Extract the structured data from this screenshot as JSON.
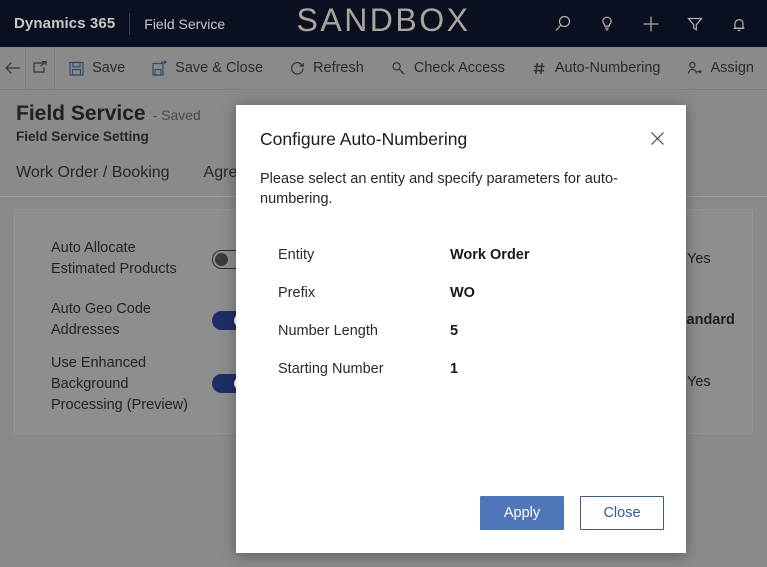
{
  "topbar": {
    "brand": "Dynamics 365",
    "app_name": "Field Service",
    "environment_label": "SANDBOX",
    "background_color": "#0b1021",
    "text_color": "#c9c7c4",
    "icons": [
      {
        "name": "search-icon",
        "label": "Search"
      },
      {
        "name": "lightbulb-icon",
        "label": "Assistant"
      },
      {
        "name": "plus-icon",
        "label": "Quick Create"
      },
      {
        "name": "filter-icon",
        "label": "Filter"
      },
      {
        "name": "bell-icon",
        "label": "Notifications"
      }
    ]
  },
  "commandbar": {
    "background_color": "#8a8a8a",
    "back_label": "Back",
    "popout_label": "Open in new window",
    "buttons": [
      {
        "name": "save-button",
        "label": "Save",
        "icon": "save-icon"
      },
      {
        "name": "save-and-close-button",
        "label": "Save & Close",
        "icon": "save-close-icon"
      },
      {
        "name": "refresh-button",
        "label": "Refresh",
        "icon": "refresh-icon"
      },
      {
        "name": "check-access-button",
        "label": "Check Access",
        "icon": "key-icon"
      },
      {
        "name": "auto-numbering-button",
        "label": "Auto-Numbering",
        "icon": "hash-icon"
      },
      {
        "name": "assign-button",
        "label": "Assign",
        "icon": "assign-person-icon"
      }
    ]
  },
  "record": {
    "title": "Field Service",
    "saved_status": "- Saved",
    "subtitle": "Field Service Setting"
  },
  "tabs": [
    {
      "label": "Work Order / Booking"
    },
    {
      "label": "Agree"
    }
  ],
  "settings": [
    {
      "label": "Auto Allocate Estimated Products",
      "toggle_state": "off",
      "value": "Yes"
    },
    {
      "label": "Auto Geo Code Addresses",
      "toggle_state": "on",
      "value": "/Standard"
    },
    {
      "label": "Use Enhanced Background Processing (Preview)",
      "toggle_state": "on",
      "value": "Yes"
    }
  ],
  "modal": {
    "title": "Configure Auto-Numbering",
    "description": "Please select an entity and specify parameters for auto-numbering.",
    "close_label": "Close dialog",
    "fields": [
      {
        "label": "Entity",
        "value": "Work Order"
      },
      {
        "label": "Prefix",
        "value": "WO"
      },
      {
        "label": "Number Length",
        "value": "5"
      },
      {
        "label": "Starting Number",
        "value": "1"
      }
    ],
    "apply_label": "Apply",
    "close_button_label": "Close",
    "primary_color": "#4f76b8"
  }
}
